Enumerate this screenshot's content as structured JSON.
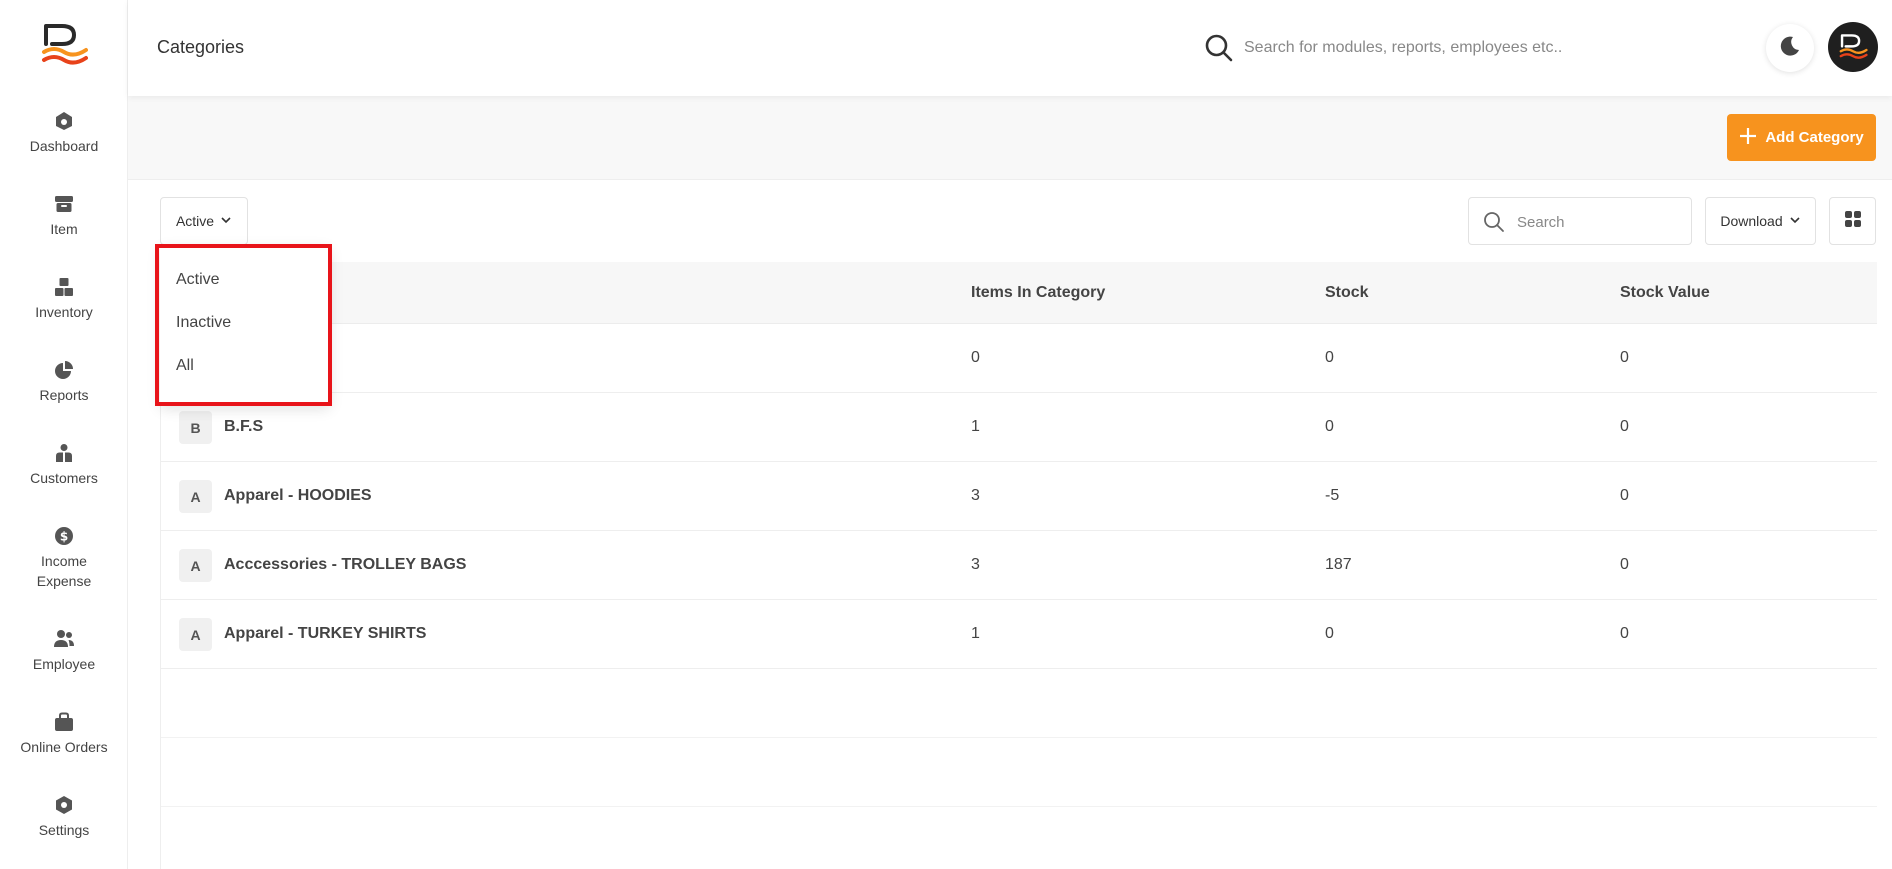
{
  "sidebar": {
    "items": [
      {
        "label": "Dashboard",
        "icon": "dashboard-icon"
      },
      {
        "label": "Item",
        "icon": "archive-icon"
      },
      {
        "label": "Inventory",
        "icon": "boxes-icon"
      },
      {
        "label": "Reports",
        "icon": "pie-chart-icon"
      },
      {
        "label": "Customers",
        "icon": "customers-icon"
      },
      {
        "label": "Income\nExpense",
        "icon": "dollar-icon"
      },
      {
        "label": "Employee",
        "icon": "users-icon"
      },
      {
        "label": "Online Orders",
        "icon": "bag-icon"
      },
      {
        "label": "Settings",
        "icon": "gear-icon"
      }
    ]
  },
  "header": {
    "title": "Categories",
    "search_placeholder": "Search for modules, reports, employees etc.."
  },
  "actions": {
    "add_label": "Add Category"
  },
  "controls": {
    "filter_value": "Active",
    "search_placeholder": "Search",
    "download_label": "Download"
  },
  "dropdown": {
    "options": [
      "Active",
      "Inactive",
      "All"
    ]
  },
  "table": {
    "columns": [
      "Items In Category",
      "Stock",
      "Stock Value"
    ],
    "rows": [
      {
        "badge": "",
        "name": "",
        "items": "0",
        "stock": "0",
        "value": "0"
      },
      {
        "badge": "B",
        "name": "B.F.S",
        "items": "1",
        "stock": "0",
        "value": "0"
      },
      {
        "badge": "A",
        "name": "Apparel - HOODIES",
        "items": "3",
        "stock": "-5",
        "value": "0"
      },
      {
        "badge": "A",
        "name": "Acccessories - TROLLEY BAGS",
        "items": "3",
        "stock": "187",
        "value": "0"
      },
      {
        "badge": "A",
        "name": "Apparel - TURKEY SHIRTS",
        "items": "1",
        "stock": "0",
        "value": "0"
      }
    ]
  },
  "colors": {
    "accent": "#f7931e",
    "highlight": "#e8141a",
    "icon": "#555555"
  }
}
